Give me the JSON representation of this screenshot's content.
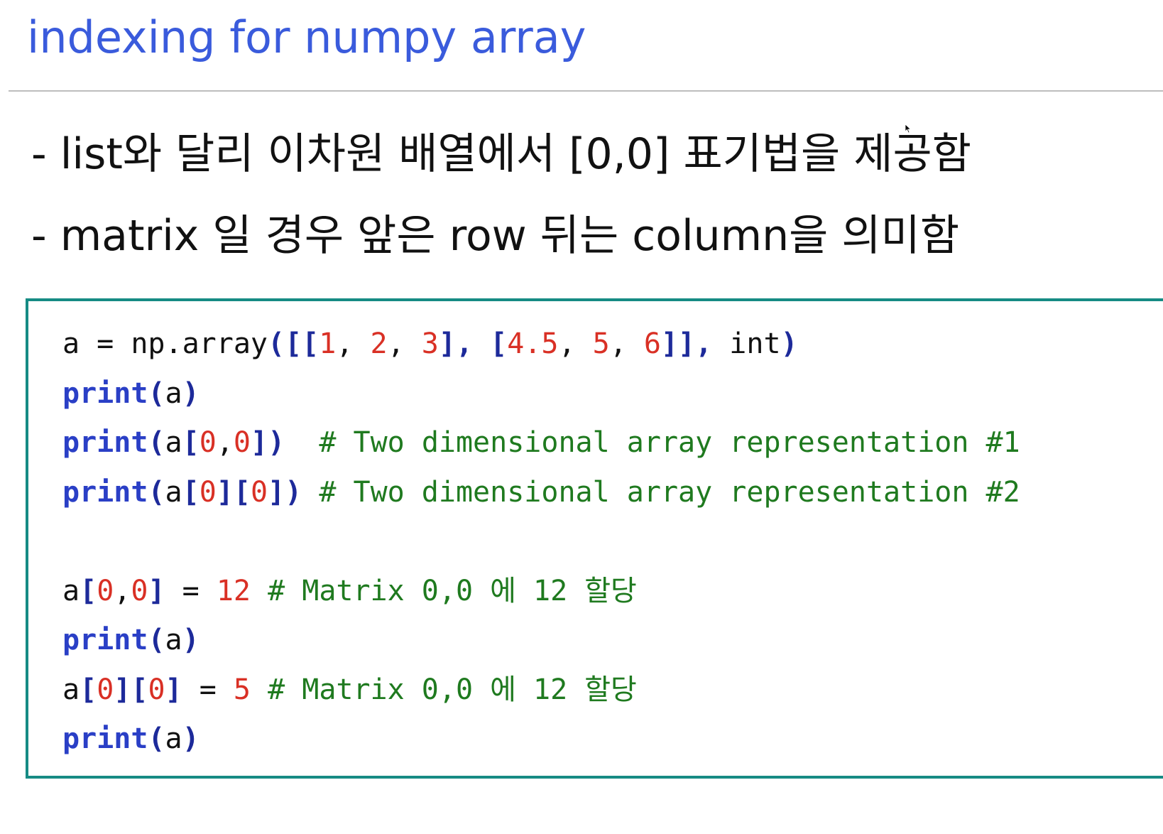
{
  "title": "indexing for numpy array",
  "bullets": [
    "- list와 달리 이차원 배열에서 [0,0] 표기법을 제공함",
    "- matrix 일 경우 앞은 row 뒤는 column을 의미함"
  ],
  "code_lines": [
    [
      {
        "t": "a = np.array",
        "k": "tx"
      },
      {
        "t": "([[",
        "k": "br"
      },
      {
        "t": "1",
        "k": "num"
      },
      {
        "t": ", ",
        "k": "tx"
      },
      {
        "t": "2",
        "k": "num"
      },
      {
        "t": ", ",
        "k": "tx"
      },
      {
        "t": "3",
        "k": "num"
      },
      {
        "t": "], [",
        "k": "br"
      },
      {
        "t": "4.5",
        "k": "num"
      },
      {
        "t": ", ",
        "k": "tx"
      },
      {
        "t": "5",
        "k": "num"
      },
      {
        "t": ", ",
        "k": "tx"
      },
      {
        "t": "6",
        "k": "num"
      },
      {
        "t": "]], ",
        "k": "br"
      },
      {
        "t": "int",
        "k": "tx"
      },
      {
        "t": ")",
        "k": "br"
      }
    ],
    [
      {
        "t": "print",
        "k": "kw"
      },
      {
        "t": "(",
        "k": "br"
      },
      {
        "t": "a",
        "k": "tx"
      },
      {
        "t": ")",
        "k": "br"
      }
    ],
    [
      {
        "t": "print",
        "k": "kw"
      },
      {
        "t": "(",
        "k": "br"
      },
      {
        "t": "a",
        "k": "tx"
      },
      {
        "t": "[",
        "k": "br"
      },
      {
        "t": "0",
        "k": "num"
      },
      {
        "t": ",",
        "k": "tx"
      },
      {
        "t": "0",
        "k": "num"
      },
      {
        "t": "])",
        "k": "br"
      },
      {
        "t": "  # Two dimensional array representation #1",
        "k": "cm"
      }
    ],
    [
      {
        "t": "print",
        "k": "kw"
      },
      {
        "t": "(",
        "k": "br"
      },
      {
        "t": "a",
        "k": "tx"
      },
      {
        "t": "[",
        "k": "br"
      },
      {
        "t": "0",
        "k": "num"
      },
      {
        "t": "][",
        "k": "br"
      },
      {
        "t": "0",
        "k": "num"
      },
      {
        "t": "])",
        "k": "br"
      },
      {
        "t": " # Two dimensional array representation #2",
        "k": "cm"
      }
    ],
    [],
    [
      {
        "t": "a",
        "k": "tx"
      },
      {
        "t": "[",
        "k": "br"
      },
      {
        "t": "0",
        "k": "num"
      },
      {
        "t": ",",
        "k": "tx"
      },
      {
        "t": "0",
        "k": "num"
      },
      {
        "t": "]",
        "k": "br"
      },
      {
        "t": " = ",
        "k": "tx"
      },
      {
        "t": "12",
        "k": "num"
      },
      {
        "t": " # Matrix 0,0 에 12 할당",
        "k": "cm"
      }
    ],
    [
      {
        "t": "print",
        "k": "kw"
      },
      {
        "t": "(",
        "k": "br"
      },
      {
        "t": "a",
        "k": "tx"
      },
      {
        "t": ")",
        "k": "br"
      }
    ],
    [
      {
        "t": "a",
        "k": "tx"
      },
      {
        "t": "[",
        "k": "br"
      },
      {
        "t": "0",
        "k": "num"
      },
      {
        "t": "][",
        "k": "br"
      },
      {
        "t": "0",
        "k": "num"
      },
      {
        "t": "]",
        "k": "br"
      },
      {
        "t": " = ",
        "k": "tx"
      },
      {
        "t": "5",
        "k": "num"
      },
      {
        "t": " # Matrix 0,0 에 12 할당",
        "k": "cm"
      }
    ],
    [
      {
        "t": "print",
        "k": "kw"
      },
      {
        "t": "(",
        "k": "br"
      },
      {
        "t": "a",
        "k": "tx"
      },
      {
        "t": ")",
        "k": "br"
      }
    ]
  ],
  "colors": {
    "title": "#3a5bdc",
    "rule": "#bdbdbd",
    "box_border": "#168b84",
    "text": "#111111",
    "keyword": "#2a3fc6",
    "bracket": "#1d2a9a",
    "number": "#d93025",
    "comment": "#1f7a1f"
  },
  "icons": {
    "cursor": "mouse-pointer-icon"
  }
}
